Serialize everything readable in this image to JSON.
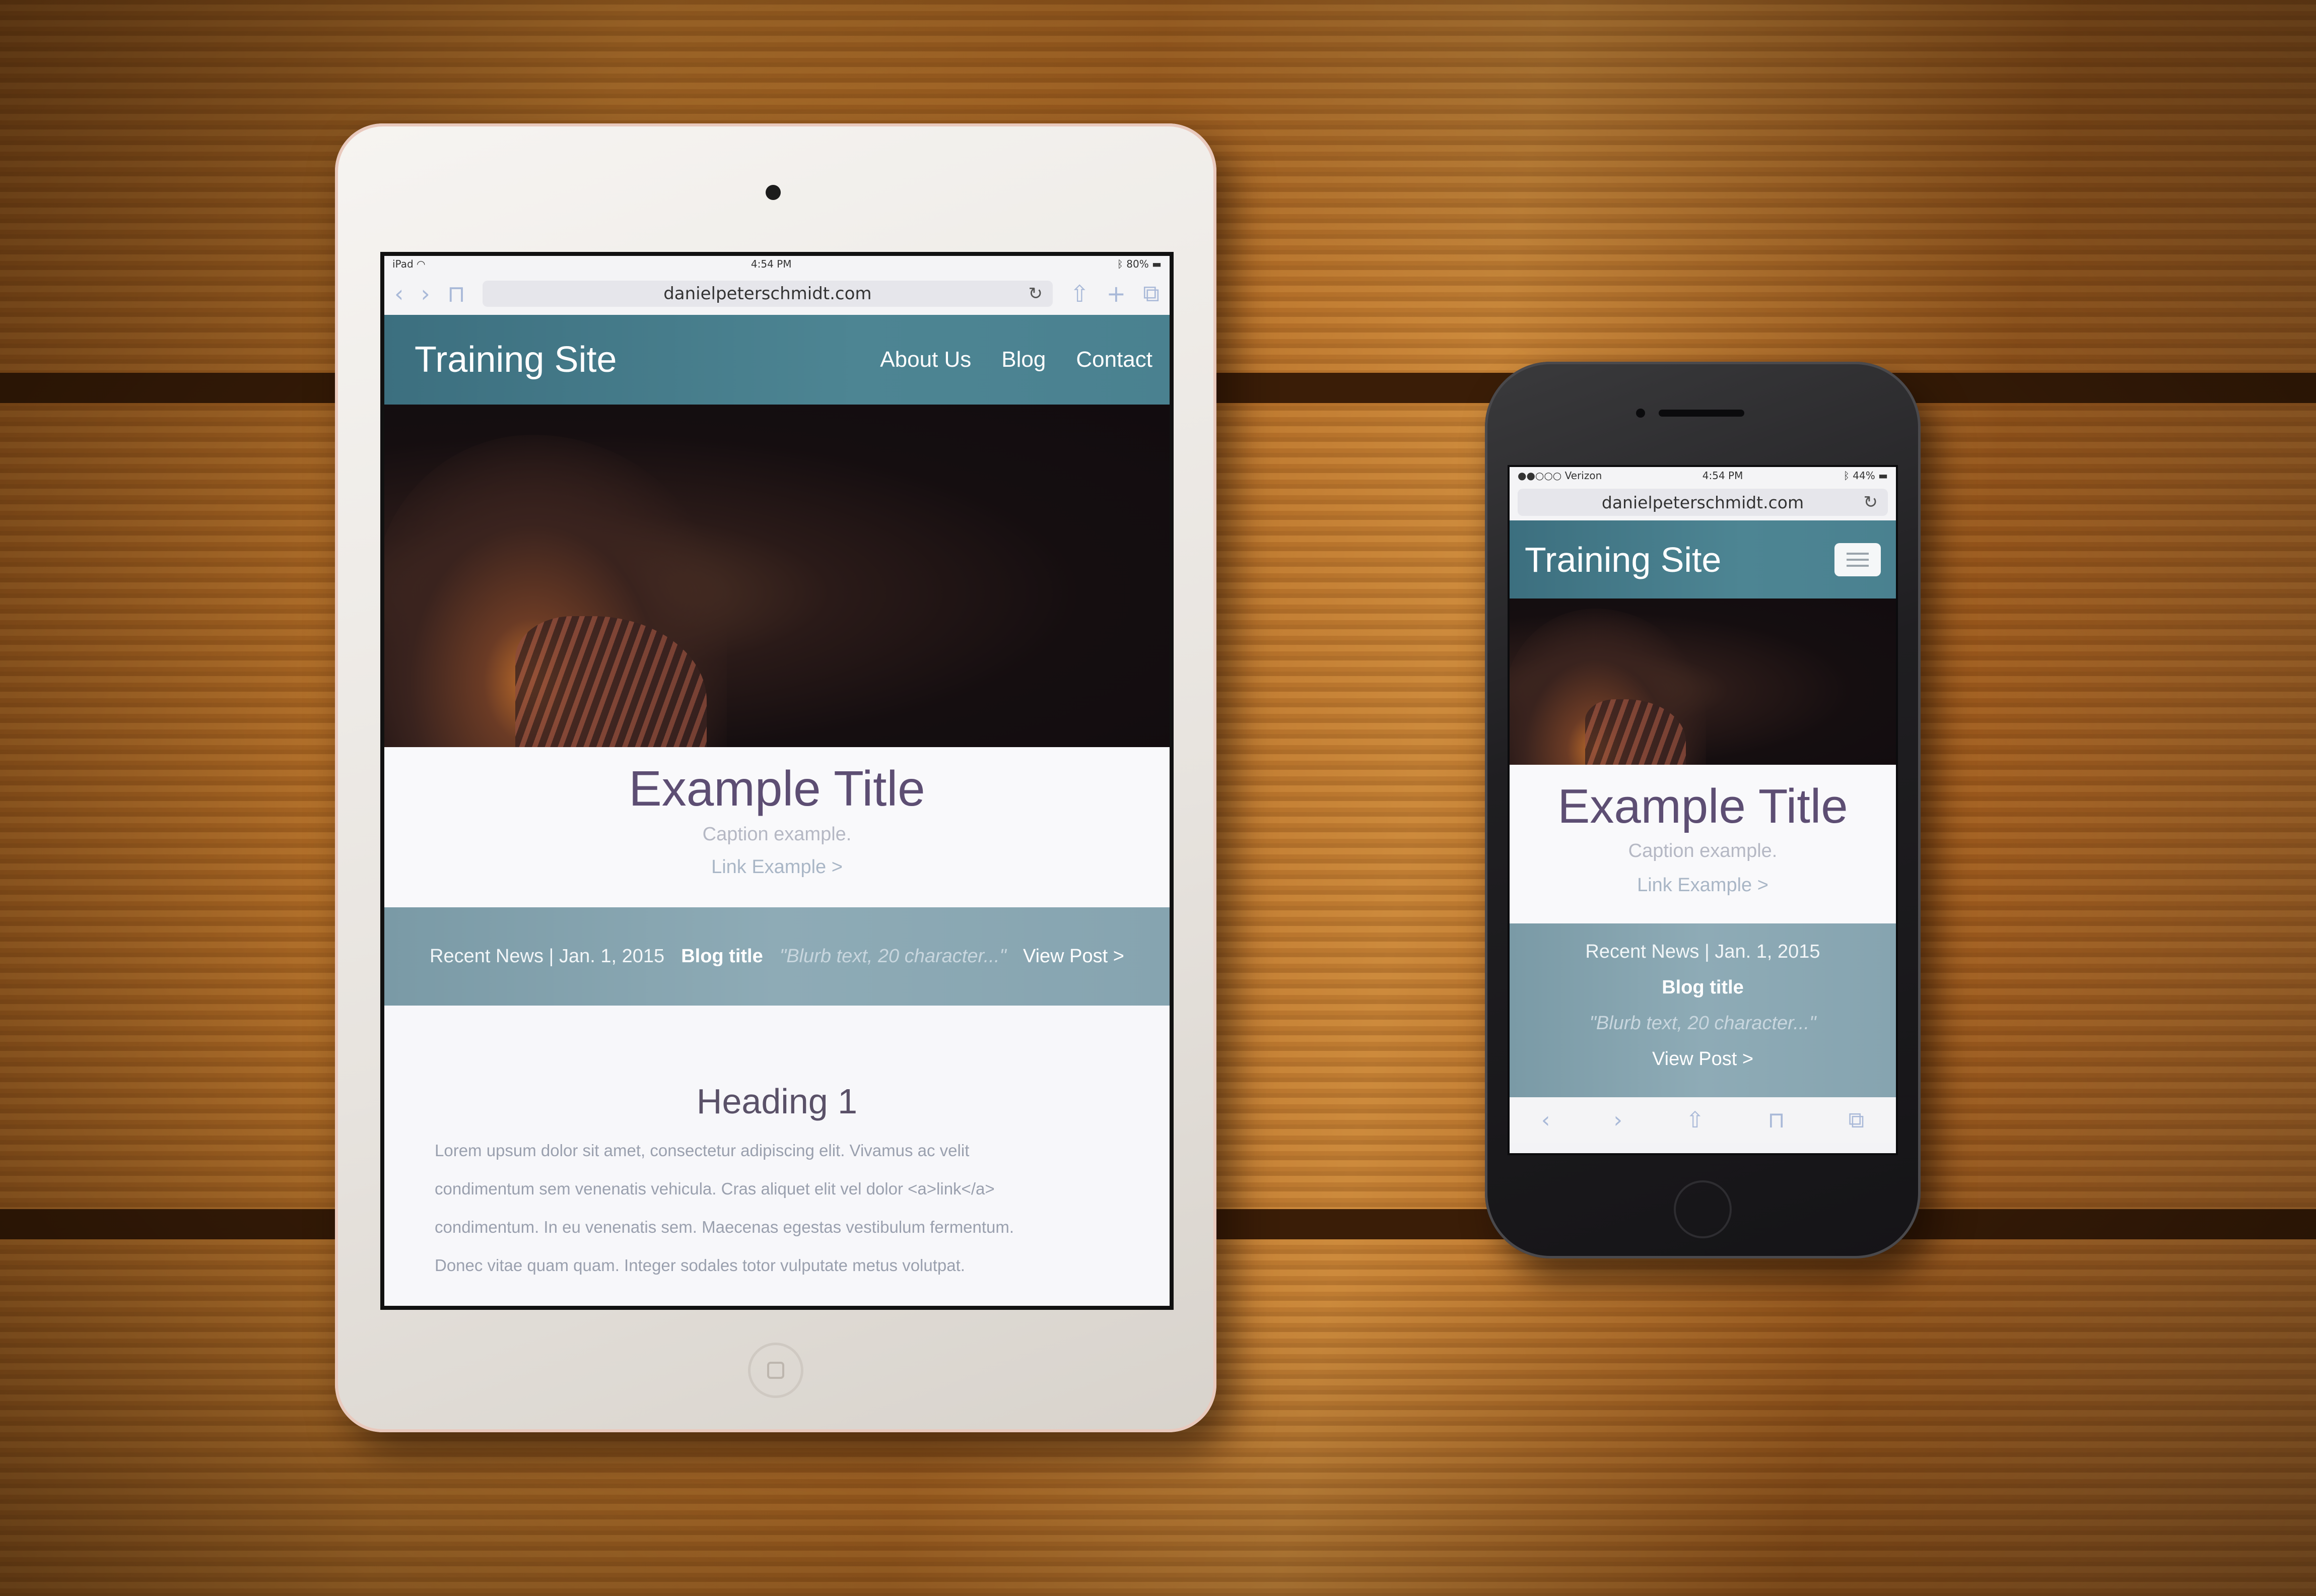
{
  "ipad": {
    "status": {
      "carrier": "iPad",
      "time": "4:54 PM",
      "battery": "80%"
    },
    "url": "danielpeterschmidt.com",
    "site": {
      "brand": "Training Site",
      "nav": [
        "About Us",
        "Blog",
        "Contact"
      ],
      "title": "Example Title",
      "caption": "Caption example.",
      "link": "Link Example >",
      "news": {
        "label": "Recent News | Jan. 1, 2015",
        "blog_title": "Blog title",
        "blurb": "\"Blurb text, 20 character...\"",
        "view_post": "View Post >"
      },
      "heading": "Heading 1",
      "lorem": [
        "Lorem upsum dolor sit amet, consectetur adipiscing elit. Vivamus ac velit",
        "condimentum sem venenatis vehicula. Cras aliquet elit vel dolor <a>link</a>",
        "condimentum. In eu venenatis sem. Maecenas egestas vestibulum fermentum.",
        "Donec vitae quam quam. Integer sodales totor vulputate metus volutpat."
      ]
    }
  },
  "iphone": {
    "status": {
      "carrier": "Verizon",
      "time": "4:54 PM",
      "battery": "44%"
    },
    "url": "danielpeterschmidt.com",
    "site": {
      "brand": "Training Site",
      "title": "Example Title",
      "caption": "Caption example.",
      "link": "Link Example >",
      "news": {
        "label": "Recent News | Jan. 1, 2015",
        "blog_title": "Blog title",
        "blurb": "\"Blurb text, 20 character...\"",
        "view_post": "View Post >"
      }
    }
  },
  "icons": {
    "back": "chevron-left-icon",
    "forward": "chevron-right-icon",
    "bookmarks": "book-icon",
    "reload": "reload-icon",
    "share": "share-icon",
    "add": "plus-icon",
    "tabs": "tabs-icon",
    "menu": "hamburger-icon"
  },
  "colors": {
    "header_teal": "#4a8190",
    "news_bar": "#86a4b0",
    "title_purple": "#5d4e73"
  }
}
